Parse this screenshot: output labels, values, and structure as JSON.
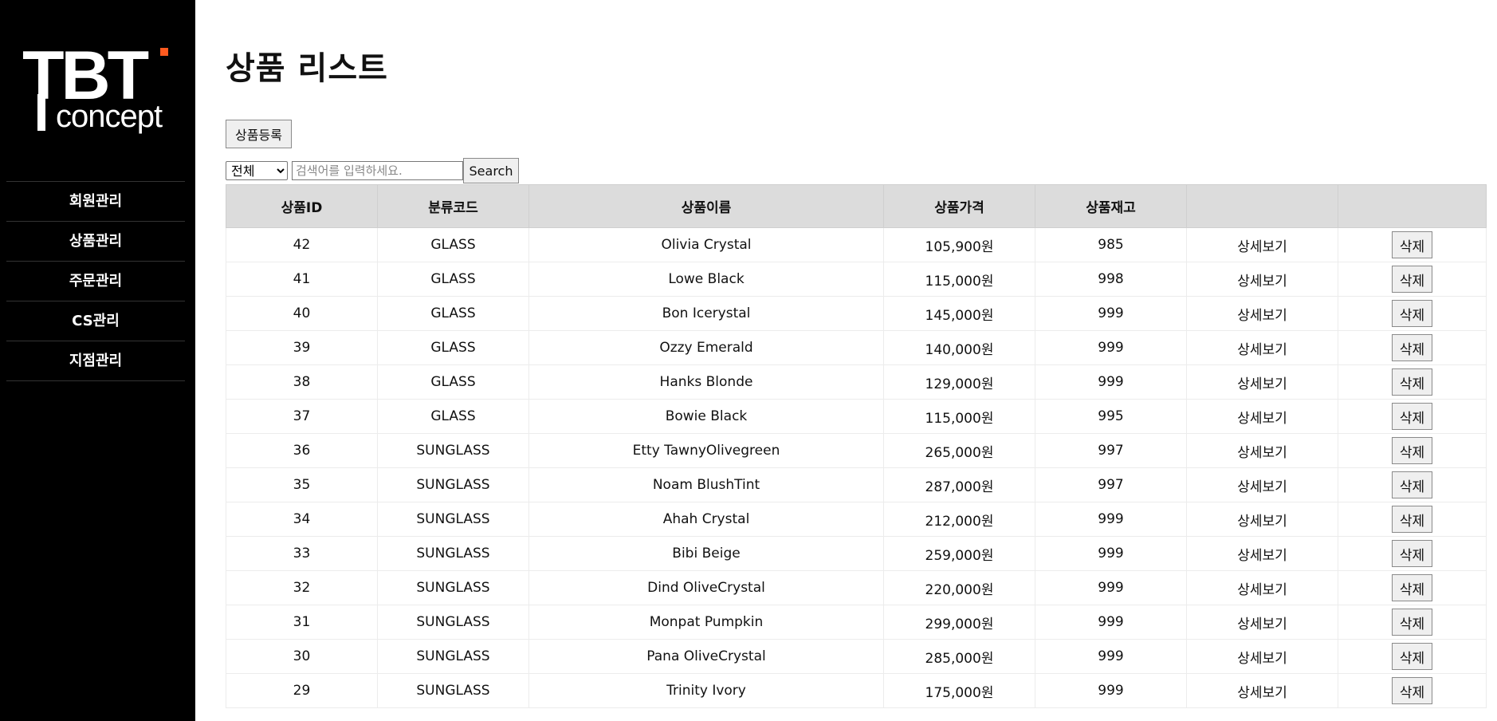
{
  "sidebar": {
    "logo": {
      "top": "TBT",
      "bottom": "concept",
      "accent_color": "#ff5a1f"
    },
    "menu": [
      "회원관리",
      "상품관리",
      "주문관리",
      "CS관리",
      "지점관리"
    ]
  },
  "main": {
    "title": "상품 리스트",
    "register_button": "상품등록",
    "search": {
      "category_selected": "전체",
      "placeholder": "검색어를 입력하세요.",
      "button": "Search"
    },
    "table": {
      "headers": [
        "상품ID",
        "분류코드",
        "상품이름",
        "상품가격",
        "상품재고",
        "",
        ""
      ],
      "detail_label": "상세보기",
      "delete_label": "삭제",
      "rows": [
        {
          "id": "42",
          "category": "GLASS",
          "name": "Olivia Crystal",
          "price": "105,900원",
          "stock": "985"
        },
        {
          "id": "41",
          "category": "GLASS",
          "name": "Lowe Black",
          "price": "115,000원",
          "stock": "998"
        },
        {
          "id": "40",
          "category": "GLASS",
          "name": "Bon Icerystal",
          "price": "145,000원",
          "stock": "999"
        },
        {
          "id": "39",
          "category": "GLASS",
          "name": "Ozzy Emerald",
          "price": "140,000원",
          "stock": "999"
        },
        {
          "id": "38",
          "category": "GLASS",
          "name": "Hanks Blonde",
          "price": "129,000원",
          "stock": "999"
        },
        {
          "id": "37",
          "category": "GLASS",
          "name": "Bowie Black",
          "price": "115,000원",
          "stock": "995"
        },
        {
          "id": "36",
          "category": "SUNGLASS",
          "name": "Etty TawnyOlivegreen",
          "price": "265,000원",
          "stock": "997"
        },
        {
          "id": "35",
          "category": "SUNGLASS",
          "name": "Noam BlushTint",
          "price": "287,000원",
          "stock": "997"
        },
        {
          "id": "34",
          "category": "SUNGLASS",
          "name": "Ahah Crystal",
          "price": "212,000원",
          "stock": "999"
        },
        {
          "id": "33",
          "category": "SUNGLASS",
          "name": "Bibi Beige",
          "price": "259,000원",
          "stock": "999"
        },
        {
          "id": "32",
          "category": "SUNGLASS",
          "name": "Dind OliveCrystal",
          "price": "220,000원",
          "stock": "999"
        },
        {
          "id": "31",
          "category": "SUNGLASS",
          "name": "Monpat Pumpkin",
          "price": "299,000원",
          "stock": "999"
        },
        {
          "id": "30",
          "category": "SUNGLASS",
          "name": "Pana OliveCrystal",
          "price": "285,000원",
          "stock": "999"
        },
        {
          "id": "29",
          "category": "SUNGLASS",
          "name": "Trinity Ivory",
          "price": "175,000원",
          "stock": "999"
        }
      ]
    }
  }
}
